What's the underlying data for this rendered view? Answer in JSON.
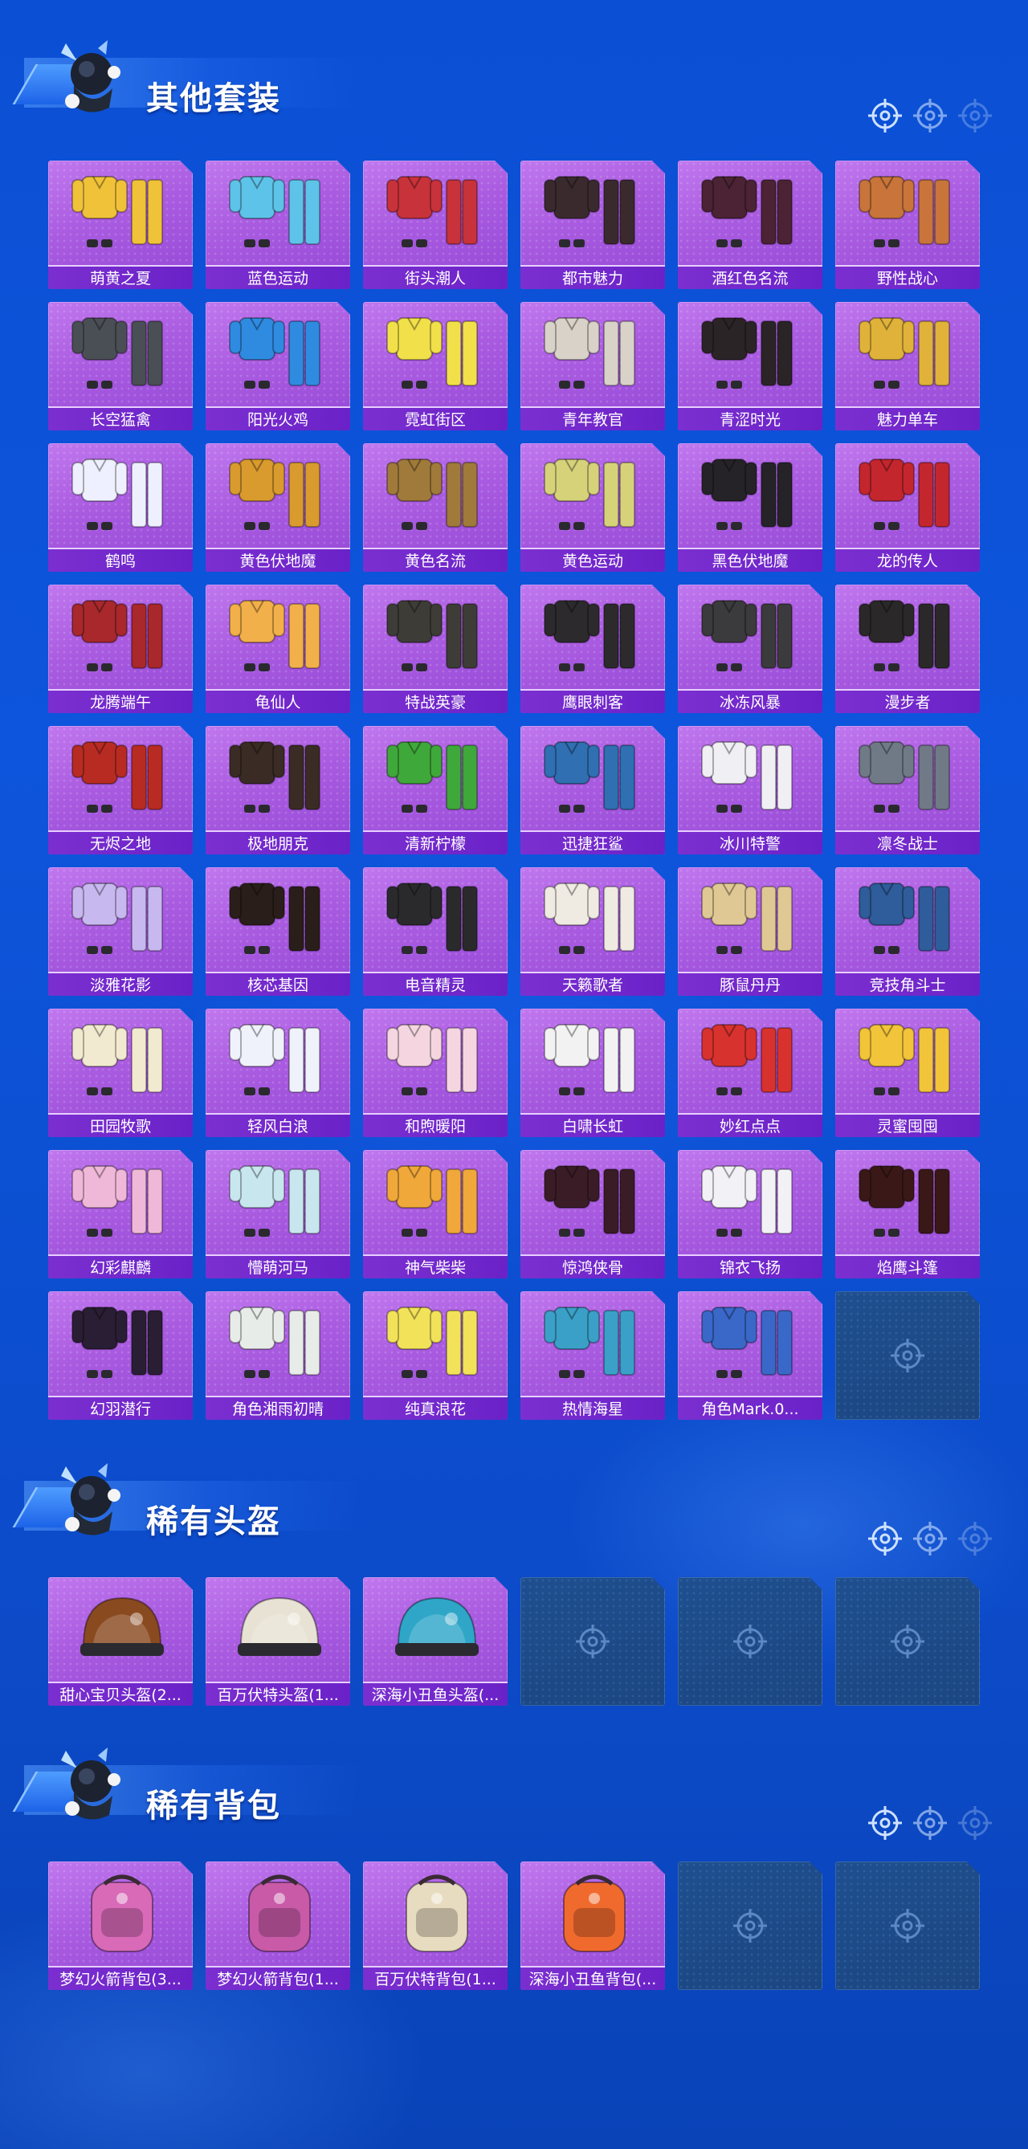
{
  "colors": {
    "background": "#0b4fd4",
    "card": "#a95be0",
    "card_label": "#7b2fd0",
    "empty_card": "#1f4f8f"
  },
  "sections": [
    {
      "title": "其他套装",
      "items": [
        {
          "name": "萌黄之夏",
          "hue": "#f0c23a"
        },
        {
          "name": "蓝色运动",
          "hue": "#5ec3e8"
        },
        {
          "name": "街头潮人",
          "hue": "#c8323a"
        },
        {
          "name": "都市魅力",
          "hue": "#3a2a2e"
        },
        {
          "name": "酒红色名流",
          "hue": "#4b2334"
        },
        {
          "name": "野性战心",
          "hue": "#c8743a"
        },
        {
          "name": "长空猛禽",
          "hue": "#4a4f55"
        },
        {
          "name": "阳光火鸡",
          "hue": "#2f8be0"
        },
        {
          "name": "霓虹街区",
          "hue": "#f2e04a"
        },
        {
          "name": "青年教官",
          "hue": "#d8d2c8"
        },
        {
          "name": "青涩时光",
          "hue": "#2b2427"
        },
        {
          "name": "魅力单车",
          "hue": "#e0b23a"
        },
        {
          "name": "鹤鸣",
          "hue": "#eef0ff"
        },
        {
          "name": "黄色伏地魔",
          "hue": "#d99a2e"
        },
        {
          "name": "黄色名流",
          "hue": "#a07a3a"
        },
        {
          "name": "黄色运动",
          "hue": "#d6d27a"
        },
        {
          "name": "黑色伏地魔",
          "hue": "#252327"
        },
        {
          "name": "龙的传人",
          "hue": "#c4262e"
        },
        {
          "name": "龙腾端午",
          "hue": "#a8282c"
        },
        {
          "name": "龟仙人",
          "hue": "#f2b04a"
        },
        {
          "name": "特战英豪",
          "hue": "#3e3c36"
        },
        {
          "name": "鹰眼刺客",
          "hue": "#2c2a2c"
        },
        {
          "name": "冰冻风暴",
          "hue": "#3b3a3c"
        },
        {
          "name": "漫步者",
          "hue": "#2a2829"
        },
        {
          "name": "无烬之地",
          "hue": "#b82b22"
        },
        {
          "name": "极地朋克",
          "hue": "#3a2b24"
        },
        {
          "name": "清新柠檬",
          "hue": "#3fa83a"
        },
        {
          "name": "迅捷狂鲨",
          "hue": "#2f6fb2"
        },
        {
          "name": "冰川特警",
          "hue": "#f0f0f4"
        },
        {
          "name": "凛冬战士",
          "hue": "#707a86"
        },
        {
          "name": "淡雅花影",
          "hue": "#c8b8f0"
        },
        {
          "name": "核芯基因",
          "hue": "#2a1e1a"
        },
        {
          "name": "电音精灵",
          "hue": "#2a2a2c"
        },
        {
          "name": "天籁歌者",
          "hue": "#efeae2"
        },
        {
          "name": "豚鼠丹丹",
          "hue": "#e0c894"
        },
        {
          "name": "竞技角斗士",
          "hue": "#2f5c9a"
        },
        {
          "name": "田园牧歌",
          "hue": "#f2ead0"
        },
        {
          "name": "轻风白浪",
          "hue": "#f0f2fb"
        },
        {
          "name": "和煦暖阳",
          "hue": "#f5d6e0"
        },
        {
          "name": "白啸长虹",
          "hue": "#f2f2f2"
        },
        {
          "name": "妙红点点",
          "hue": "#d8322e"
        },
        {
          "name": "灵蜜囤囤",
          "hue": "#f2c43a"
        },
        {
          "name": "幻彩麒麟",
          "hue": "#f0b8d8"
        },
        {
          "name": "懵萌河马",
          "hue": "#c8e6ee"
        },
        {
          "name": "神气柴柴",
          "hue": "#f0a83a"
        },
        {
          "name": "惊鸿侠骨",
          "hue": "#3a1c26"
        },
        {
          "name": "锦衣飞扬",
          "hue": "#f2f2f6"
        },
        {
          "name": "焰鹰斗篷",
          "hue": "#3a1818"
        },
        {
          "name": "幻羽潜行",
          "hue": "#2a1e34"
        },
        {
          "name": "角色湘雨初晴",
          "hue": "#e8ece8"
        },
        {
          "name": "纯真浪花",
          "hue": "#f2e25a"
        },
        {
          "name": "热情海星",
          "hue": "#3aa0c8"
        },
        {
          "name": "角色Mark.0...",
          "hue": "#3a68c8"
        }
      ],
      "empty_slots": 1
    },
    {
      "title": "稀有头盔",
      "items": [
        {
          "name": "甜心宝贝头盔(2...",
          "hue": "#8a4a20"
        },
        {
          "name": "百万伏特头盔(1...",
          "hue": "#e8e2d4"
        },
        {
          "name": "深海小丑鱼头盔(...",
          "hue": "#2fa6c8"
        }
      ],
      "empty_slots": 3
    },
    {
      "title": "稀有背包",
      "items": [
        {
          "name": "梦幻火箭背包(3...",
          "hue": "#d86ab8"
        },
        {
          "name": "梦幻火箭背包(1...",
          "hue": "#c85aa8"
        },
        {
          "name": "百万伏特背包(1...",
          "hue": "#e8dcc0"
        },
        {
          "name": "深海小丑鱼背包(...",
          "hue": "#f06a2e"
        }
      ],
      "empty_slots": 2
    }
  ]
}
